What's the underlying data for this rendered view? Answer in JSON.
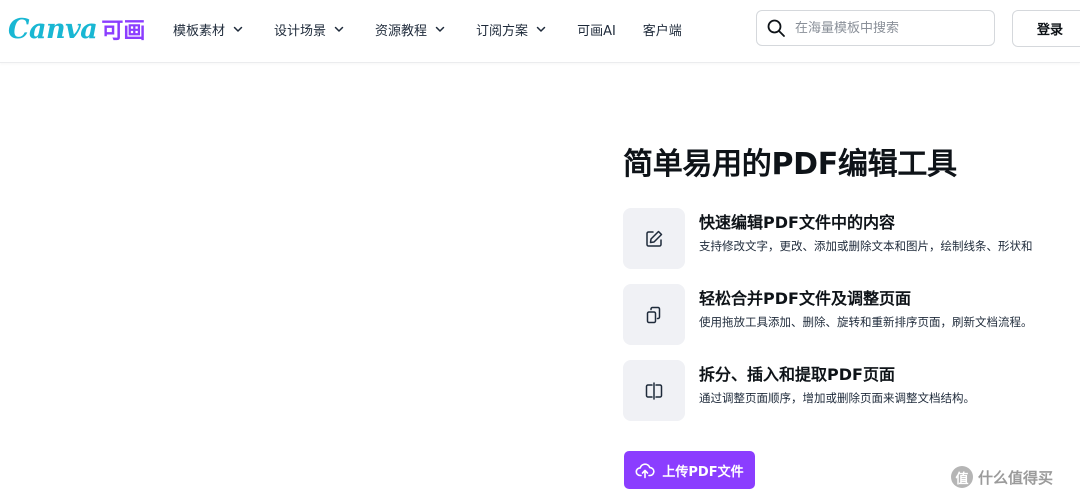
{
  "header": {
    "logo": {
      "wordmark": "Canva",
      "cn": "可画"
    },
    "nav": [
      {
        "label": "模板素材",
        "dropdown": true
      },
      {
        "label": "设计场景",
        "dropdown": true
      },
      {
        "label": "资源教程",
        "dropdown": true
      },
      {
        "label": "订阅方案",
        "dropdown": true
      },
      {
        "label": "可画AI",
        "dropdown": false
      },
      {
        "label": "客户端",
        "dropdown": false
      }
    ],
    "search": {
      "placeholder": "在海量模板中搜索",
      "value": ""
    },
    "login_label": "登录"
  },
  "main": {
    "title": "简单易用的PDF编辑工具",
    "features": [
      {
        "icon": "edit-icon",
        "title": "快速编辑PDF文件中的内容",
        "description": "支持修改文字，更改、添加或删除文本和图片，绘制线条、形状和"
      },
      {
        "icon": "pages-icon",
        "title": "轻松合并PDF文件及调整页面",
        "description": "使用拖放工具添加、删除、旋转和重新排序页面，刷新文档流程。"
      },
      {
        "icon": "split-icon",
        "title": "拆分、插入和提取PDF页面",
        "description": "通过调整页面顺序，增加或删除页面来调整文档结构。"
      }
    ],
    "upload_label": "上传PDF文件"
  },
  "watermark": {
    "badge": "值",
    "text": "什么值得买"
  },
  "colors": {
    "brand_purple": "#8b3dff",
    "logo_teal": "#19b7d3",
    "icon_bg": "#f0f1f5"
  }
}
